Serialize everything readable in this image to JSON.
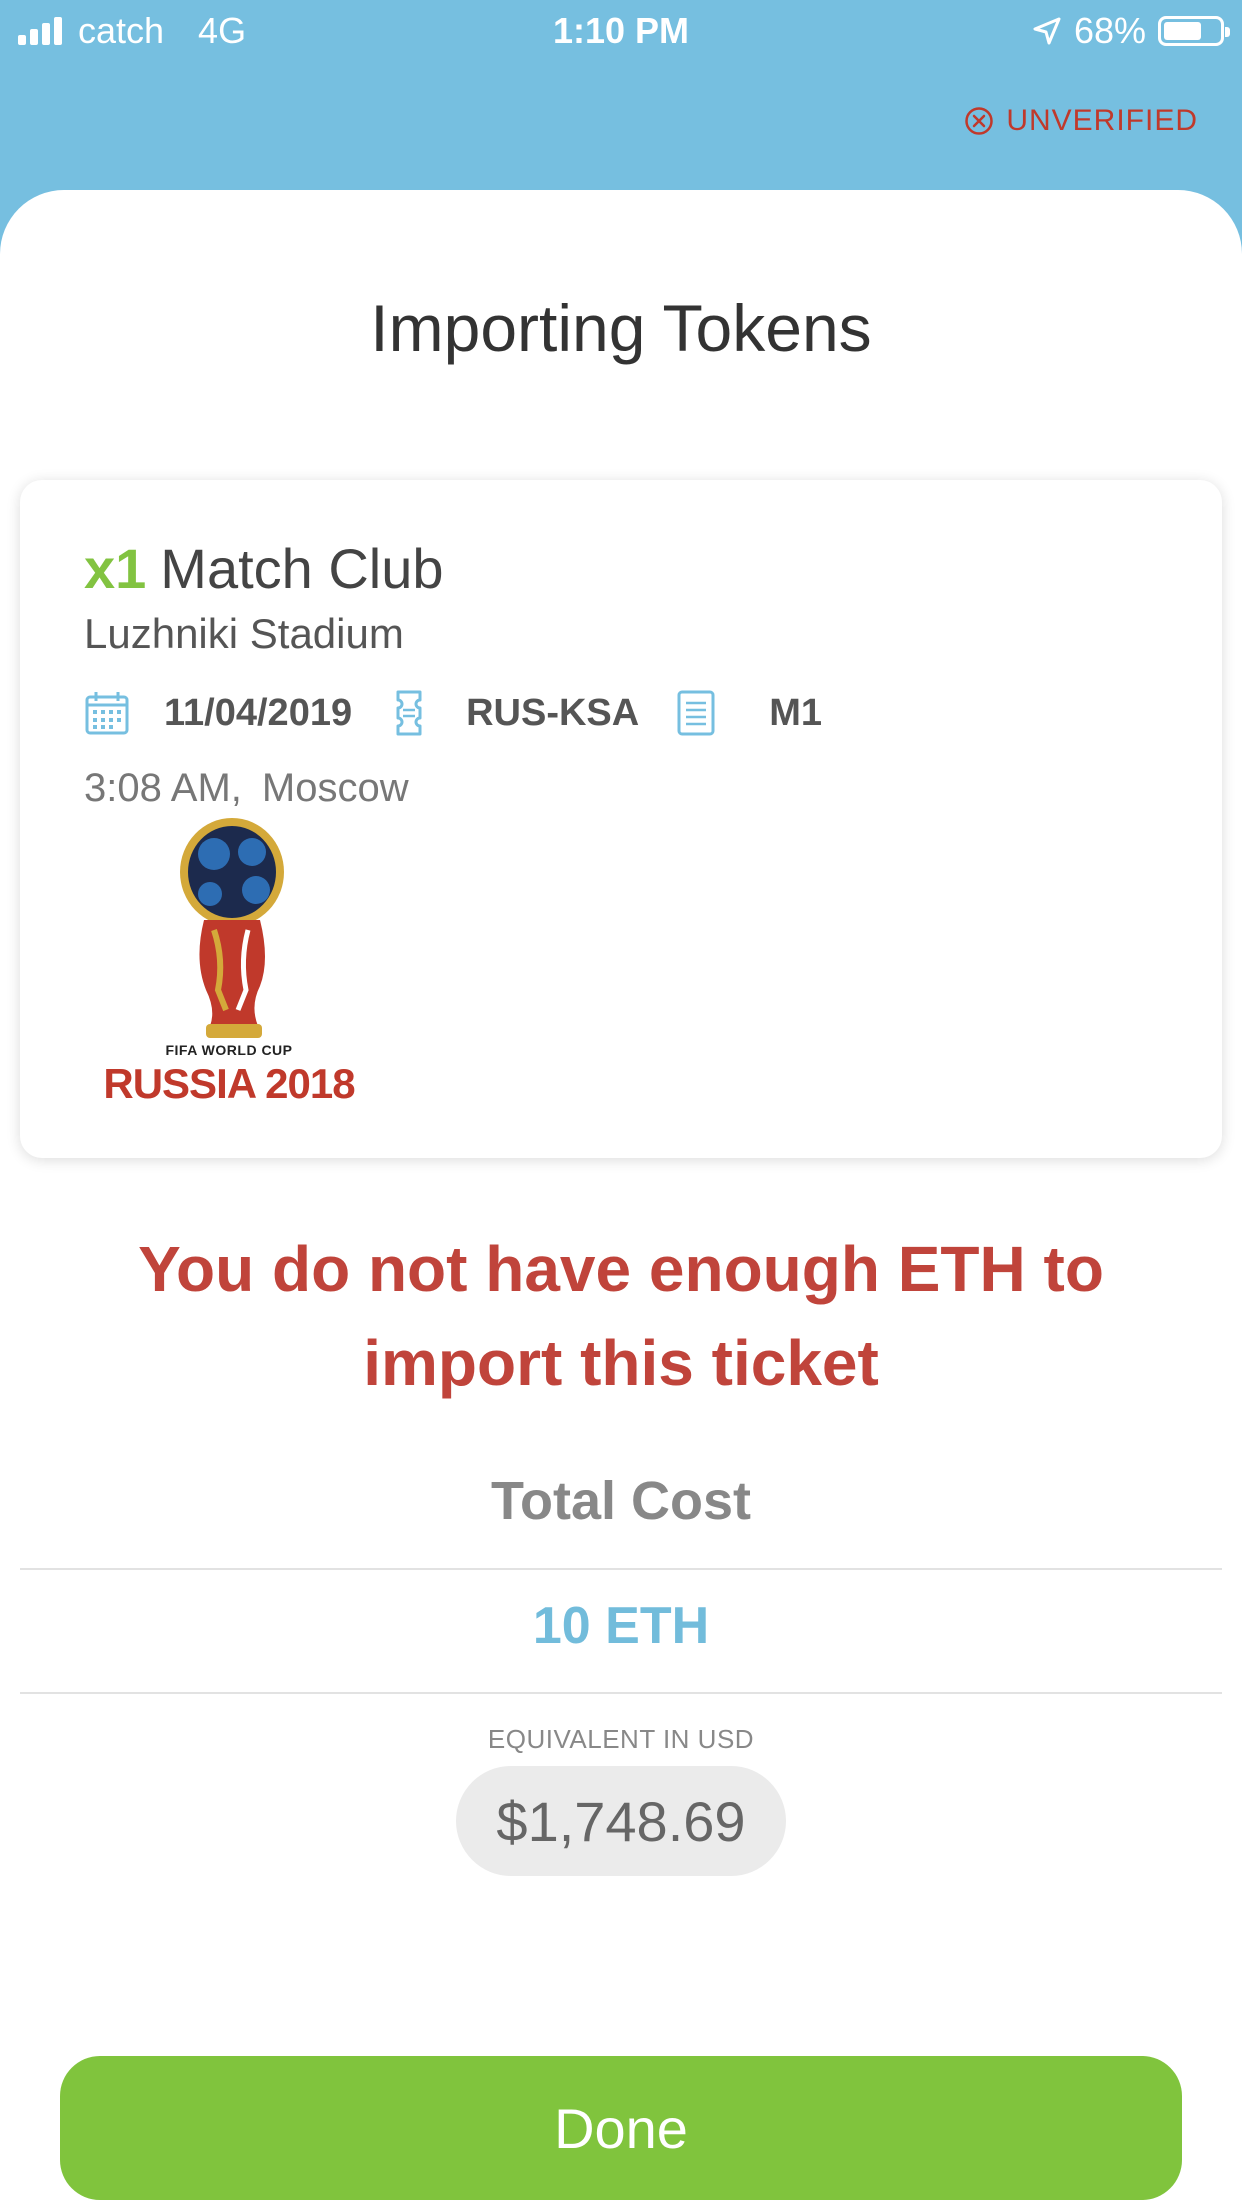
{
  "status_bar": {
    "carrier": "catch",
    "network": "4G",
    "time": "1:10 PM",
    "battery": "68%",
    "battery_level": 0.68
  },
  "header": {
    "verification_status": "UNVERIFIED",
    "verification_color": "#c0392b"
  },
  "sheet": {
    "title": "Importing Tokens"
  },
  "ticket": {
    "quantity": "x1",
    "name": "Match Club",
    "venue": "Luzhniki Stadium",
    "date": "11/04/2019",
    "match": "RUS-KSA",
    "match_code": "M1",
    "time": "3:08 AM,",
    "city": "Moscow",
    "logo": {
      "line1": "FIFA WORLD CUP",
      "line2": "RUSSIA 2018"
    },
    "icons": [
      "calendar-icon",
      "ticket-icon",
      "list-icon"
    ]
  },
  "error_message": "You do not have enough ETH to import this ticket",
  "cost": {
    "label": "Total Cost",
    "value": "10 ETH",
    "usd_label": "EQUIVALENT IN USD",
    "usd_value": "$1,748.69"
  },
  "actions": {
    "done_label": "Done"
  },
  "colors": {
    "header_bg": "#76bfe0",
    "accent_green": "#80c43d",
    "error_red": "#c0443b",
    "eth_blue": "#72bcdb"
  }
}
